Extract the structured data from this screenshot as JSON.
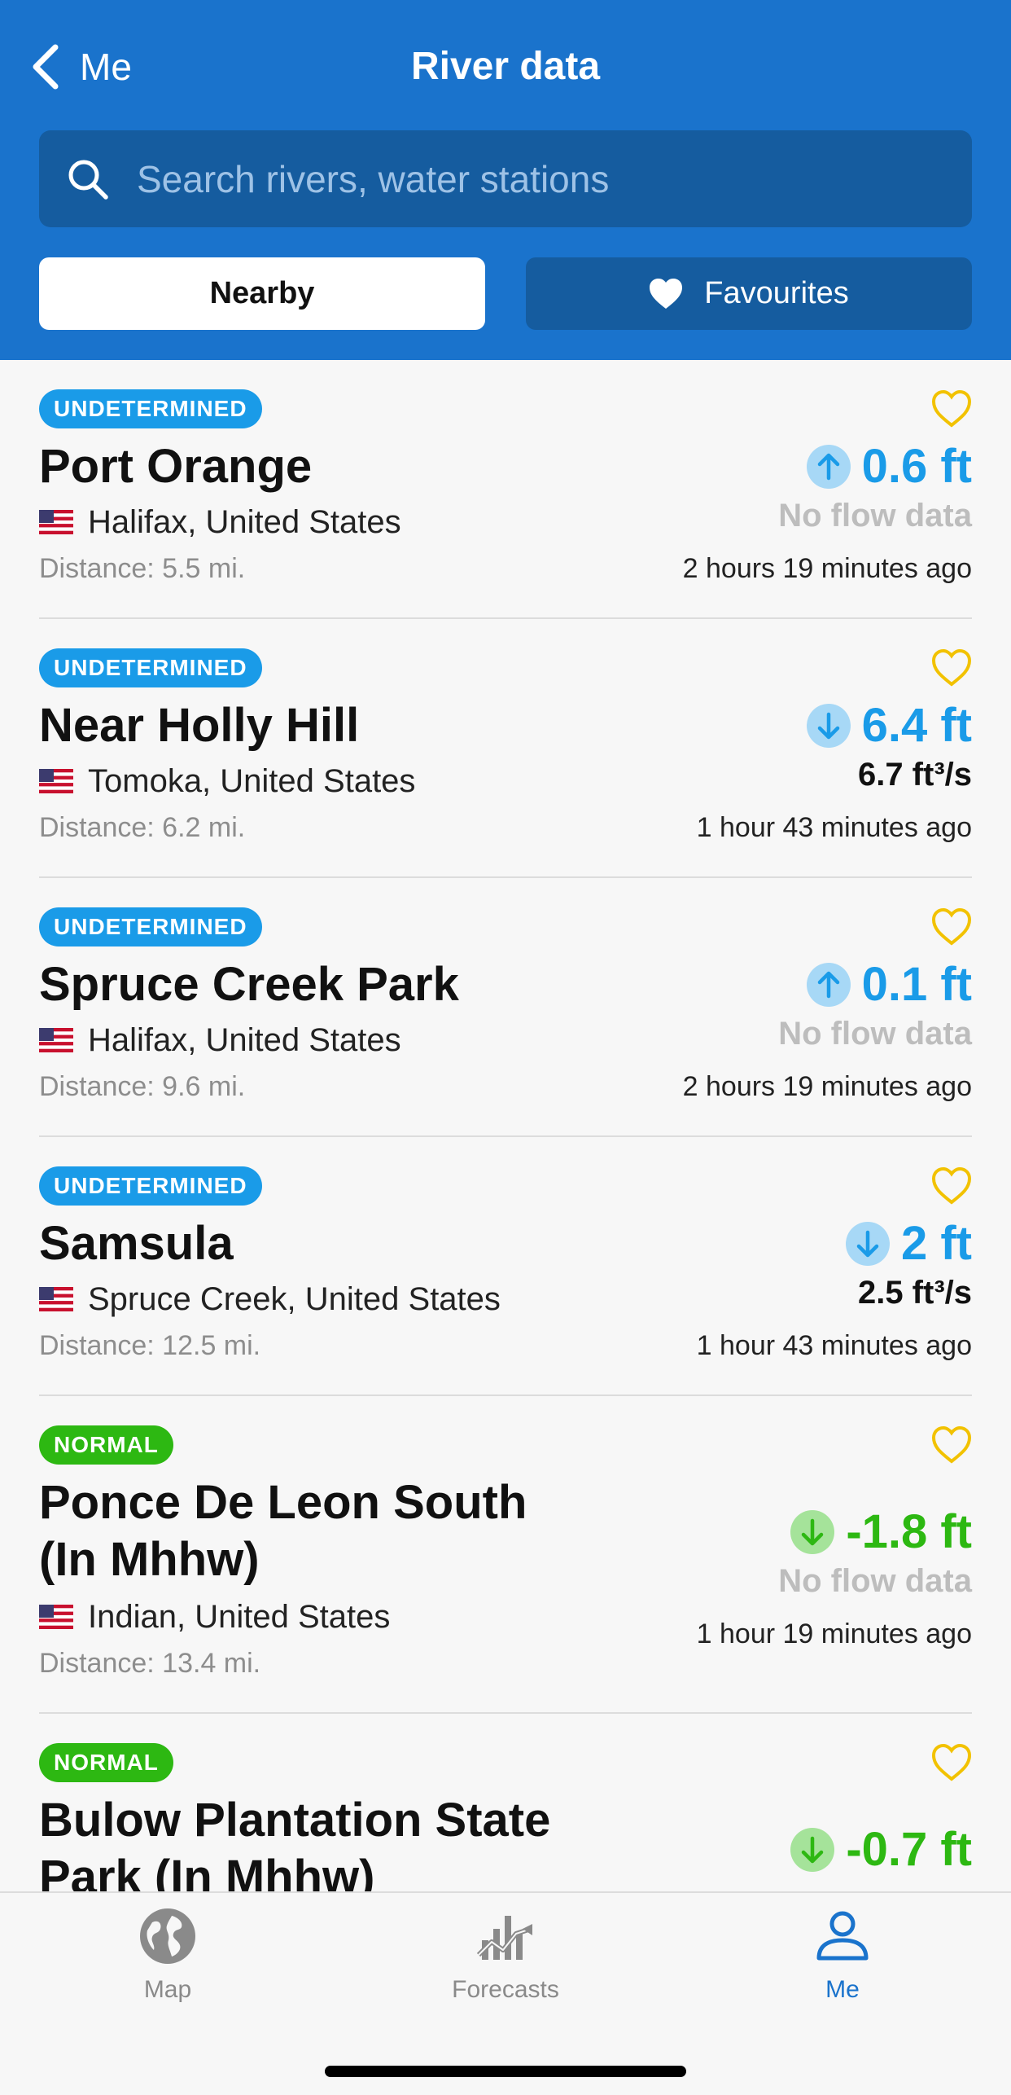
{
  "nav": {
    "back_label": "Me",
    "title": "River data"
  },
  "search": {
    "placeholder": "Search rivers, water stations"
  },
  "segments": {
    "nearby": "Nearby",
    "favourites": "Favourites"
  },
  "items": [
    {
      "status": "UNDETERMINED",
      "status_color": "#1a9be8",
      "name": "Port Orange",
      "location": "Halifax, United States",
      "distance": "Distance: 5.5 mi.",
      "level": "0.6 ft",
      "trend": "up",
      "level_color": "#1a9be8",
      "flow": "No flow data",
      "time": "2 hours 19 minutes ago"
    },
    {
      "status": "UNDETERMINED",
      "status_color": "#1a9be8",
      "name": "Near Holly Hill",
      "location": "Tomoka, United States",
      "distance": "Distance: 6.2 mi.",
      "level": "6.4 ft",
      "trend": "down",
      "level_color": "#1a9be8",
      "flow": "6.7 ft³/s",
      "time": "1 hour 43 minutes ago"
    },
    {
      "status": "UNDETERMINED",
      "status_color": "#1a9be8",
      "name": "Spruce Creek Park",
      "location": "Halifax, United States",
      "distance": "Distance: 9.6 mi.",
      "level": "0.1 ft",
      "trend": "up",
      "level_color": "#1a9be8",
      "flow": "No flow data",
      "time": "2 hours 19 minutes ago"
    },
    {
      "status": "UNDETERMINED",
      "status_color": "#1a9be8",
      "name": "Samsula",
      "location": "Spruce Creek, United States",
      "distance": "Distance: 12.5 mi.",
      "level": "2 ft",
      "trend": "down",
      "level_color": "#1a9be8",
      "flow": "2.5 ft³/s",
      "time": "1 hour 43 minutes ago"
    },
    {
      "status": "NORMAL",
      "status_color": "#2db812",
      "name": "Ponce De Leon South (In Mhhw)",
      "location": "Indian, United States",
      "distance": "Distance: 13.4 mi.",
      "level": "-1.8 ft",
      "trend": "down",
      "level_color": "#2db812",
      "flow": "No flow data",
      "time": "1 hour 19 minutes ago"
    },
    {
      "status": "NORMAL",
      "status_color": "#2db812",
      "name": "Bulow Plantation State Park (In Mhhw)",
      "level": "-0.7 ft",
      "trend": "down",
      "level_color": "#2db812"
    }
  ],
  "tabs": [
    {
      "label": "Map",
      "icon": "globe-icon",
      "active": false
    },
    {
      "label": "Forecasts",
      "icon": "chart-trend-icon",
      "active": false
    },
    {
      "label": "Me",
      "icon": "person-icon",
      "active": true
    }
  ],
  "colors": {
    "header": "#1a73cc",
    "accent_blue": "#1a9be8",
    "accent_green": "#2db812",
    "heart": "#f2c200"
  }
}
